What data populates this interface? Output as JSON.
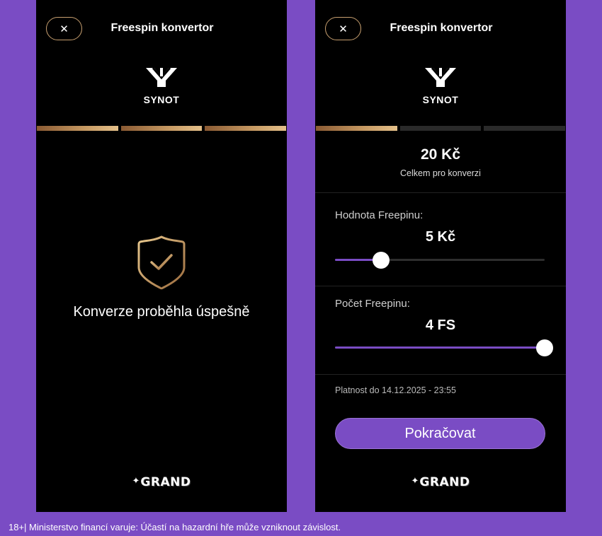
{
  "screens": [
    {
      "header": {
        "close_icon": "close-icon",
        "title": "Freespin konvertor"
      },
      "brand": {
        "logo_icon": "synot-logo-icon",
        "name": "SYNOT"
      },
      "steps": {
        "completed": 3,
        "total": 3
      },
      "success": {
        "icon": "shield-check-icon",
        "message": "Konverze proběhla úspešně"
      },
      "footer": {
        "logo": "GRAND"
      }
    },
    {
      "header": {
        "close_icon": "close-icon",
        "title": "Freespin konvertor"
      },
      "brand": {
        "logo_icon": "synot-logo-icon",
        "name": "SYNOT"
      },
      "steps": {
        "completed": 1,
        "total": 3
      },
      "summary": {
        "amount": "20 Kč",
        "caption": "Celkem pro konverzi"
      },
      "freespin_value": {
        "label": "Hodnota Freepinu:",
        "value": "5 Kč",
        "slider_fraction": 0.22
      },
      "freespin_count": {
        "label": "Počet Freepinu:",
        "value": "4 FS",
        "slider_fraction": 1.0
      },
      "validity": "Platnost do 14.12.2025 - 23:55",
      "continue_label": "Pokračovat",
      "footer": {
        "logo": "GRAND"
      }
    }
  ],
  "disclaimer": "18+| Ministerstvo financí varuje: Účastí na hazardní hře může vzniknout závislost.",
  "colors": {
    "background": "#7a4cc4",
    "accent": "#7a4cc4",
    "gold": "#c79a63",
    "screen": "#000000"
  }
}
